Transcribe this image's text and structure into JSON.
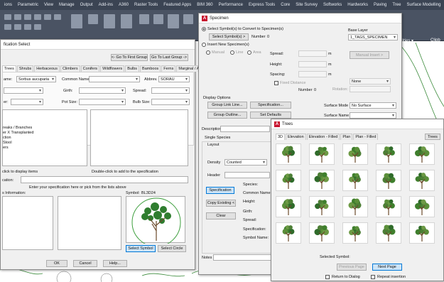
{
  "ribbon": {
    "tabs": [
      "ions",
      "Parametric",
      "View",
      "Manage",
      "Output",
      "Add-ins",
      "A360",
      "Raster Tools",
      "Featured Apps",
      "BIM 360",
      "Performance",
      "Express Tools",
      "Core",
      "Site Survey",
      "Softworks",
      "Hardworks",
      "Paving",
      "Tree",
      "Surface Modelling"
    ],
    "right_item": "ilities ▾",
    "right_item2": "Clipb"
  },
  "spec_select": {
    "title": "fication Select",
    "goto_first": "<- Go To First Group",
    "goto_last": "Go To Last Group ->",
    "tabs": [
      "Trees",
      "Shrubs",
      "Herbaceous",
      "Climbers",
      "Conifers",
      "Wildflowers",
      "Bulbs",
      "Bamboos",
      "Ferns",
      "Marginal / A"
    ],
    "name_label": "ame:",
    "name_value": "Sorbus aucuparia",
    "common_label": "Common Name:",
    "abbrev_label": "Abbrev.",
    "abbrev_value": "SORAU",
    "girth_label": "Girth:",
    "spread_label": "Spread:",
    "pot_label": "Pot Size:",
    "bulb_label": "Bulb Size:",
    "row3_label": "er:",
    "list_items": [
      "reaks / Branches",
      "er X Transplanted",
      "ction",
      "Stool",
      "ers"
    ],
    "click_hint": "click to display items",
    "dbl_hint": "Double-click to add to the specification",
    "spec_label": "cation:",
    "spec_hint": "Enter your specification here or pick from the lists above",
    "info_label": "s Information:",
    "symbol_label": "Symbol:",
    "symbol_value": "BL3D24",
    "select_symbol": "Select Symbol",
    "select_circle": "Select Circle",
    "ok": "OK",
    "cancel": "Cancel",
    "help": "Help..."
  },
  "specimen": {
    "title": "Specimen",
    "convert_label": "Select Symbol(s) to Convert to Specimen(s)",
    "select_symbols_btn": "Select Symbol(s) >",
    "number_label": "Number",
    "number_value": "0",
    "base_layer_label": "Base Layer",
    "base_layer_value": "1_TAGS_SPECIMEN",
    "insert_label": "Insert New Specimen(s)",
    "mode_manual": "Manual",
    "mode_line": "Line",
    "mode_area": "Area",
    "spread_label": "Spread:",
    "height_label": "Height:",
    "spacing_label": "Spacing:",
    "unit_m": "m",
    "fixed_distance": "Fixed Distance",
    "rotation_label": "Rotation:",
    "number2_label": "Number",
    "number2_value": "0",
    "none_value": "None",
    "manual_insert": "Manual Insert >",
    "display_options": "Display Options",
    "group_link_line": "Group Link Line...",
    "specification_btn": "Specification...",
    "surface_mode_label": "Surface Mode",
    "surface_mode_value": "No Surface",
    "group_outline": "Group Outline...",
    "set_defaults": "Set Defaults",
    "surface_name_label": "Surface Name",
    "description_label": "Description",
    "single_species": "Single Species",
    "layout_label": "Layout",
    "density_label": "Density",
    "density_value": "Counted",
    "header_label": "Header",
    "specification_btn2": "Specification",
    "species_label": "Species:",
    "common_name_label": "Common Name:",
    "height2_label": "Height:",
    "girth2_label": "Girth:",
    "spread2_label": "Spread:",
    "specification2_label": "Specification:",
    "symbol_name_label": "Symbol Name:",
    "copy_existing": "Copy Existing <",
    "clear": "Clear",
    "notes_label": "Notes"
  },
  "trees": {
    "title": "Trees",
    "tabs": [
      "3D",
      "Elevation",
      "Elevation - Filled",
      "Plan",
      "Plan - Filled"
    ],
    "right_tab": "Trees",
    "selected_symbol_label": "Selected Symbol:",
    "previous_page": "Previous Page",
    "next_page": "Next Page",
    "return_to_dialog": "Return to Dialog",
    "repeat_insertion": "Repeat insertion"
  }
}
